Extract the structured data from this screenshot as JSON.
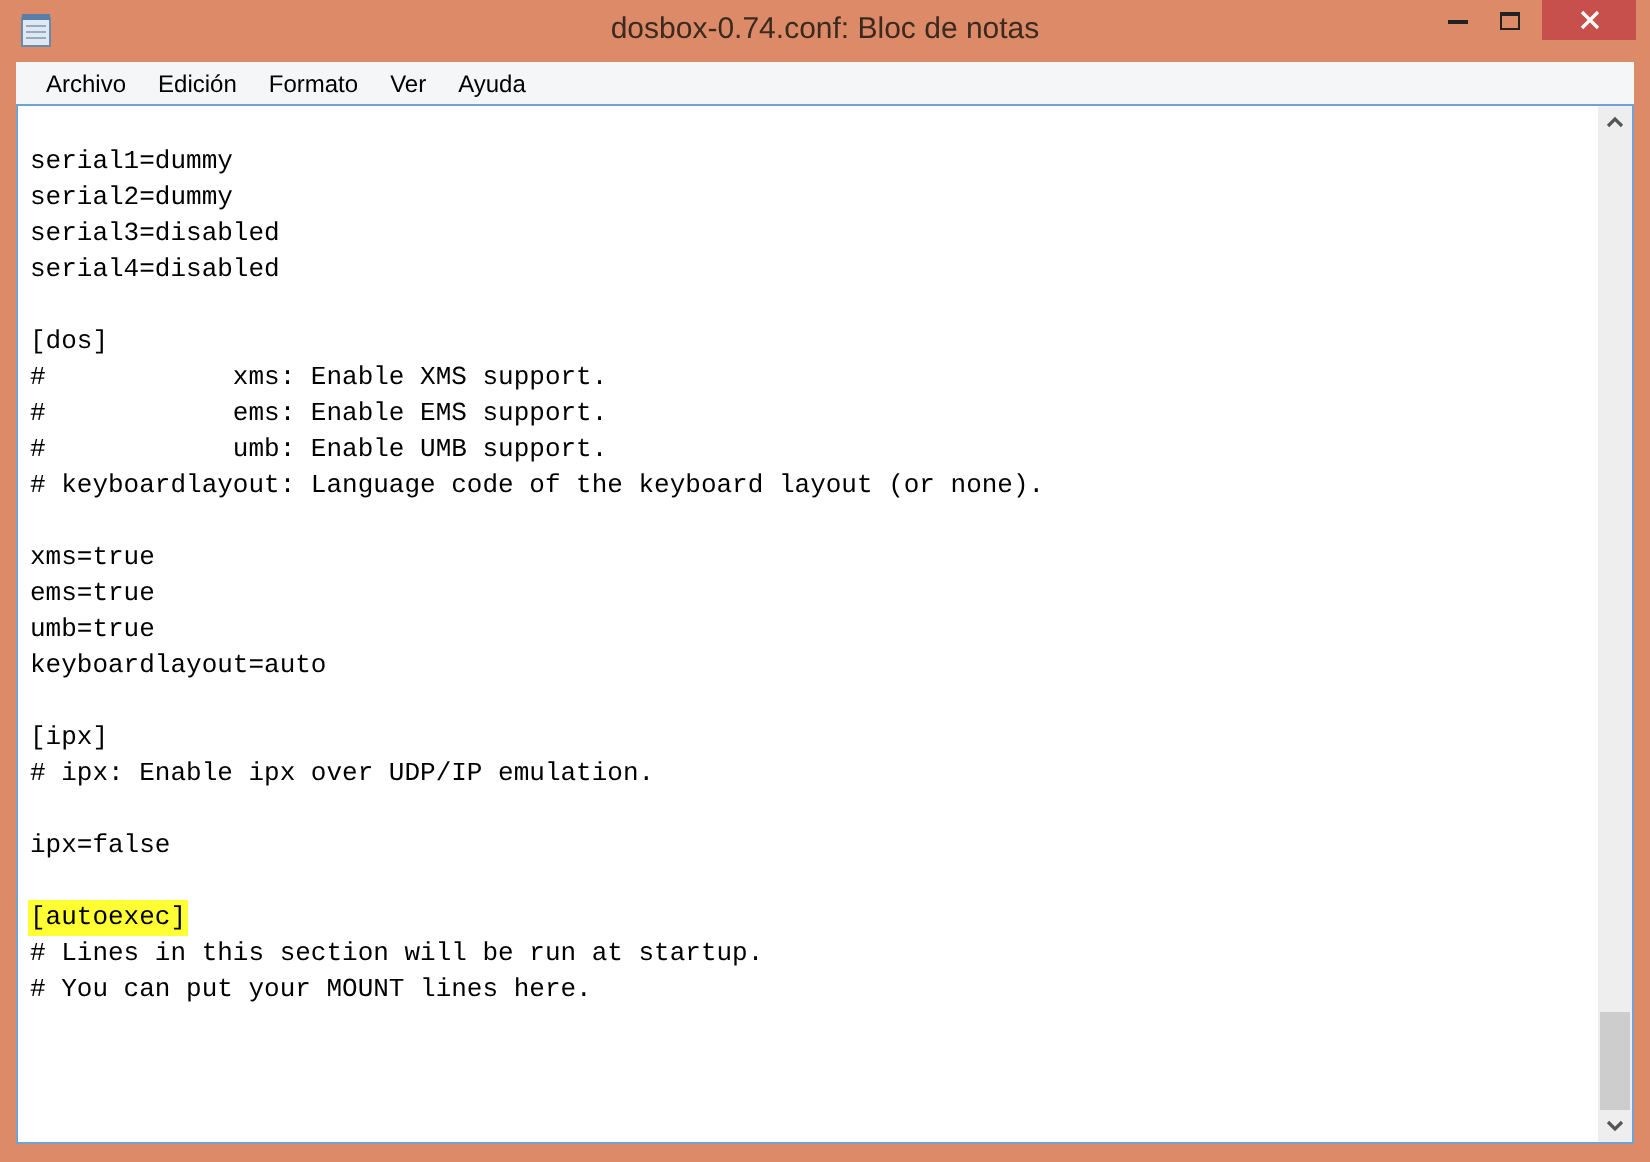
{
  "window": {
    "title": "dosbox-0.74.conf: Bloc de notas"
  },
  "menu": [
    {
      "label": "Archivo"
    },
    {
      "label": "Edición"
    },
    {
      "label": "Formato"
    },
    {
      "label": "Ver"
    },
    {
      "label": "Ayuda"
    }
  ],
  "paragraphs": [
    {
      "lines": [
        {
          "text": "serial1=dummy",
          "highlighted": false
        },
        {
          "text": "serial2=dummy",
          "highlighted": false
        },
        {
          "text": "serial3=disabled",
          "highlighted": false
        },
        {
          "text": "serial4=disabled",
          "highlighted": false
        }
      ]
    },
    {
      "lines": [
        {
          "text": "[dos]",
          "highlighted": false
        },
        {
          "text": "#            xms: Enable XMS support.",
          "highlighted": false
        },
        {
          "text": "#            ems: Enable EMS support.",
          "highlighted": false
        },
        {
          "text": "#            umb: Enable UMB support.",
          "highlighted": false
        },
        {
          "text": "# keyboardlayout: Language code of the keyboard layout (or none).",
          "highlighted": false
        }
      ]
    },
    {
      "lines": [
        {
          "text": "xms=true",
          "highlighted": false
        },
        {
          "text": "ems=true",
          "highlighted": false
        },
        {
          "text": "umb=true",
          "highlighted": false
        },
        {
          "text": "keyboardlayout=auto",
          "highlighted": false
        }
      ]
    },
    {
      "lines": [
        {
          "text": "[ipx]",
          "highlighted": false
        },
        {
          "text": "# ipx: Enable ipx over UDP/IP emulation.",
          "highlighted": false
        }
      ]
    },
    {
      "lines": [
        {
          "text": "ipx=false",
          "highlighted": false
        }
      ]
    },
    {
      "lines": [
        {
          "text": "[autoexec]",
          "highlighted": true
        },
        {
          "text": "# Lines in this section will be run at startup.",
          "highlighted": false
        },
        {
          "text": "# You can put your MOUNT lines here.",
          "highlighted": false
        }
      ]
    }
  ]
}
